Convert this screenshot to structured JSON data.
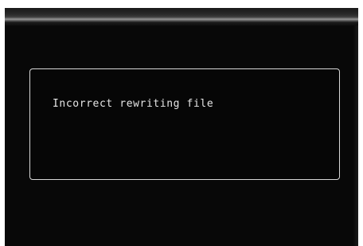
{
  "dialog": {
    "message": "Incorrect rewriting file"
  },
  "colors": {
    "screen_background": "#080808",
    "dialog_border": "#d8d8d8",
    "text": "#e6e6e6"
  }
}
